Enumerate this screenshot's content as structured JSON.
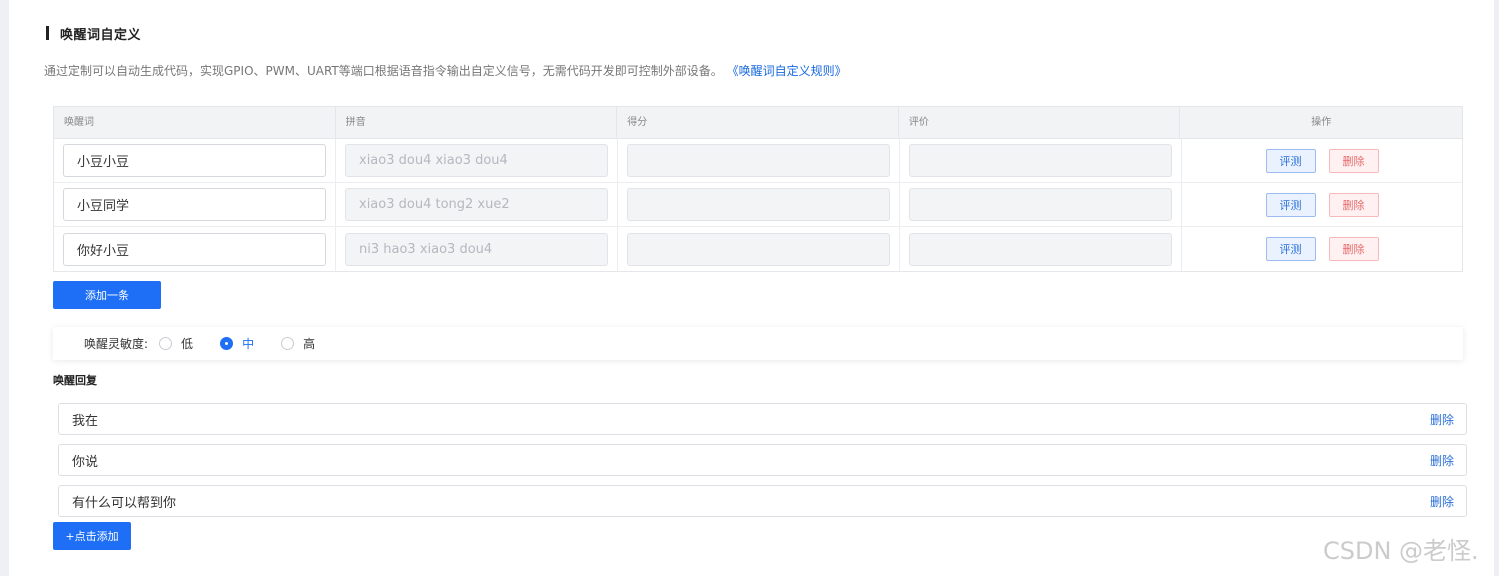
{
  "section": {
    "title": "唤醒词自定义"
  },
  "description": {
    "text": "通过定制可以自动生成代码，实现GPIO、PWM、UART等端口根据语音指令输出自定义信号，无需代码开发即可控制外部设备。",
    "link": "《唤醒词自定义规则》"
  },
  "table": {
    "headers": {
      "wake_word": "唤醒词",
      "pinyin": "拼音",
      "score": "得分",
      "rating": "评价",
      "actions": "操作"
    },
    "rows": [
      {
        "wake_word": "小豆小豆",
        "pinyin": "xiao3 dou4 xiao3 dou4",
        "score": "",
        "rating": ""
      },
      {
        "wake_word": "小豆同学",
        "pinyin": "xiao3 dou4 tong2 xue2",
        "score": "",
        "rating": ""
      },
      {
        "wake_word": "你好小豆",
        "pinyin": "ni3 hao3 xiao3 dou4",
        "score": "",
        "rating": ""
      }
    ],
    "eval_label": "评测",
    "delete_label": "删除"
  },
  "add_row_label": "添加一条",
  "sensitivity": {
    "label": "唤醒灵敏度:",
    "options": [
      "低",
      "中",
      "高"
    ],
    "selected": "中"
  },
  "reply": {
    "title": "唤醒回复",
    "items": [
      "我在",
      "你说",
      "有什么可以帮到你"
    ],
    "delete_label": "删除",
    "add_label": "+点击添加"
  },
  "watermark": "CSDN @老怪.",
  "colors": {
    "primary": "#1e6ff5",
    "link": "#1769e0",
    "danger": "#e46a6a"
  }
}
